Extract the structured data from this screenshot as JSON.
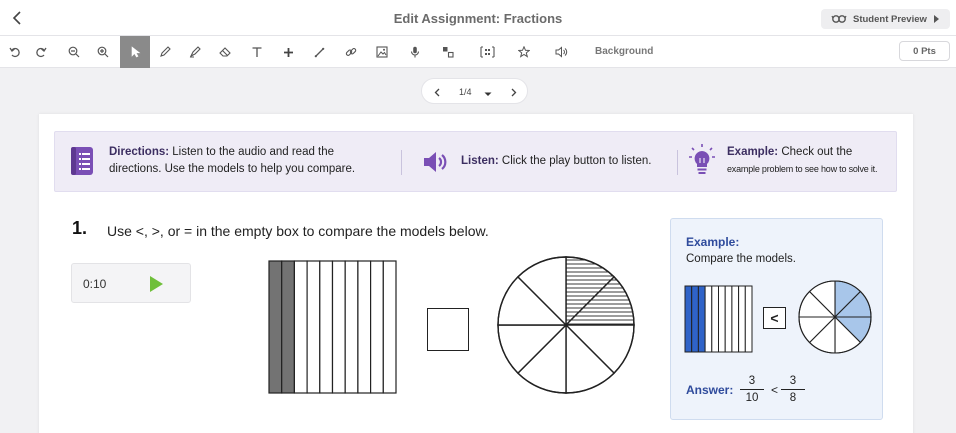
{
  "header": {
    "title": "Edit Assignment: Fractions",
    "preview_label": "Student Preview"
  },
  "toolbar": {
    "tools": [
      "undo-icon",
      "redo-icon",
      "zoom-out-icon",
      "zoom-in-icon",
      "select-pointer-icon",
      "pen-icon",
      "highlighter-icon",
      "eraser-icon",
      "text-icon",
      "plus-icon",
      "line-icon",
      "link-icon",
      "image-icon",
      "microphone-icon",
      "shapes-icon",
      "layout-icon",
      "star-icon",
      "speaker-icon"
    ],
    "active_tool": "select-pointer-icon",
    "background_label": "Background",
    "points_value": "0 Pts"
  },
  "pager": {
    "indicator": "1/4"
  },
  "directions": {
    "directions_label": "Directions:",
    "directions_text_1": "Listen to the audio and read the",
    "directions_text_2": "directions. Use the models to help you compare.",
    "listen_label": "Listen:",
    "listen_text": "Click the play button to listen.",
    "example_label": "Example:",
    "example_text_1": "Check out the",
    "example_text_2": "example problem to see how to solve it."
  },
  "question": {
    "number": "1.",
    "text": "Use <, >, or = in the empty box to compare the models below.",
    "audio_time": "0:10",
    "bar_model": {
      "parts": 10,
      "shaded": 2
    },
    "circle_model": {
      "parts": 8,
      "shaded": 2
    },
    "answer_value": ""
  },
  "example": {
    "title": "Example:",
    "subtitle": "Compare the models.",
    "bar_model": {
      "parts": 10,
      "shaded": 3
    },
    "circle_model": {
      "parts": 8,
      "shaded": 3
    },
    "comparison_symbol": "<",
    "answer_label": "Answer:",
    "left_numerator": "3",
    "left_denominator": "10",
    "symbol": "<",
    "right_numerator": "3",
    "right_denominator": "8"
  },
  "colors": {
    "accent_purple": "#7a4fb5",
    "example_blue": "#2f63c8",
    "example_circle_blue": "#a8c6ea",
    "bar_shade": "#737373",
    "play_green": "#6fbf3a"
  }
}
